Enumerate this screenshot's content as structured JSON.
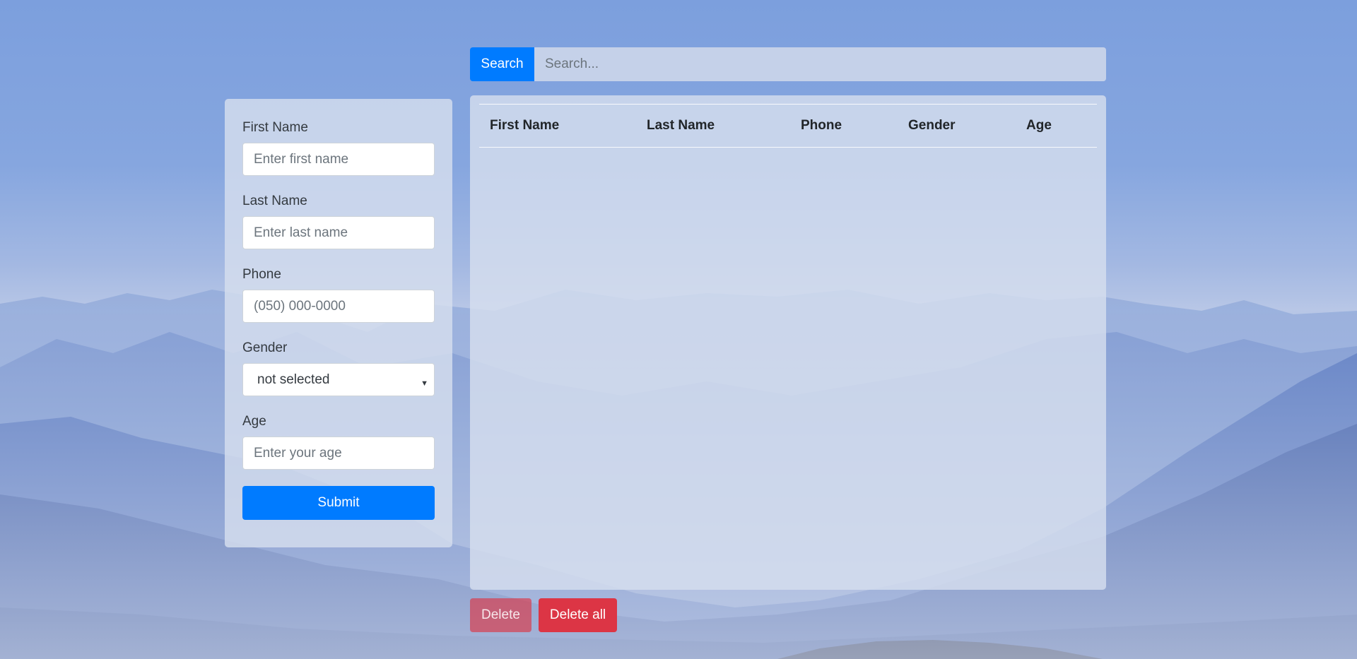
{
  "colors": {
    "primary": "#007bff",
    "danger": "#dc3545",
    "panel_bg": "rgba(214,222,238,0.82)"
  },
  "background": {
    "description_icon": "mountain-landscape"
  },
  "search": {
    "button_label": "Search",
    "placeholder": "Search...",
    "value": ""
  },
  "form": {
    "first_name": {
      "label": "First Name",
      "placeholder": "Enter first name",
      "value": ""
    },
    "last_name": {
      "label": "Last Name",
      "placeholder": "Enter last name",
      "value": ""
    },
    "phone": {
      "label": "Phone",
      "placeholder": "(050) 000-0000",
      "value": ""
    },
    "gender": {
      "label": "Gender",
      "selected": "not selected",
      "arrow_icon": "caret-down-icon"
    },
    "age": {
      "label": "Age",
      "placeholder": "Enter your age",
      "value": ""
    },
    "submit_label": "Submit"
  },
  "table": {
    "columns": [
      "First Name",
      "Last Name",
      "Phone",
      "Gender",
      "Age"
    ],
    "rows": []
  },
  "actions": {
    "delete_label": "Delete",
    "delete_all_label": "Delete all"
  }
}
